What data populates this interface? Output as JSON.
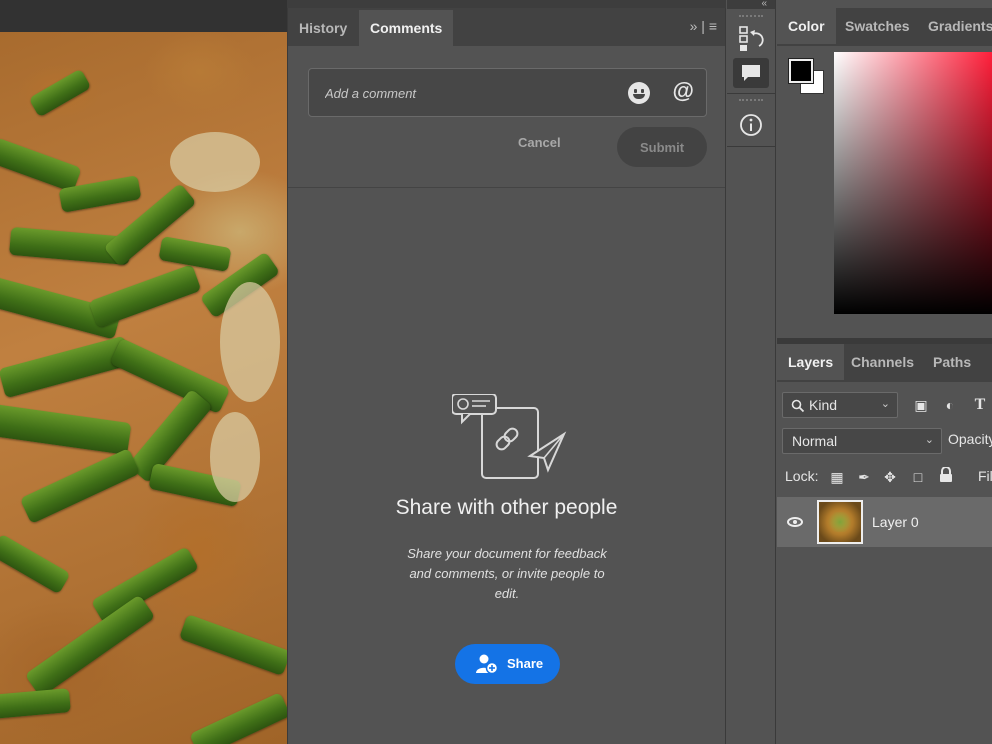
{
  "comments_panel": {
    "tabs": [
      {
        "label": "History"
      },
      {
        "label": "Comments"
      }
    ],
    "comment_placeholder": "Add a comment",
    "at_symbol": "@",
    "cancel_label": "Cancel",
    "submit_label": "Submit",
    "share_title": "Share with other people",
    "share_description": "Share your document for feedback and comments, or invite people to edit.",
    "share_button_label": "Share",
    "panel_tools": "» | ≡"
  },
  "icon_strip": {
    "collapse_glyph": "«",
    "items": [
      {
        "icon": "history-icon"
      },
      {
        "icon": "comments-icon",
        "active": true
      },
      {
        "icon": "info-icon"
      }
    ]
  },
  "color_panel": {
    "tabs": [
      {
        "label": "Color"
      },
      {
        "label": "Swatches"
      },
      {
        "label": "Gradients"
      }
    ],
    "foreground": "#000000",
    "background": "#ffffff",
    "hue_color": "#ff1f3a"
  },
  "layers_panel": {
    "tabs": [
      {
        "label": "Layers"
      },
      {
        "label": "Channels"
      },
      {
        "label": "Paths"
      }
    ],
    "filter_kind": "Kind",
    "blend_mode": "Normal",
    "opacity_label": "Opacity",
    "lock_label": "Lock:",
    "fill_label": "Fill",
    "layers": [
      {
        "name": "Layer 0",
        "visible": true
      }
    ]
  },
  "colors": {
    "accent": "#1473e6",
    "panel_bg": "#535353",
    "tabbar_bg": "#424242"
  }
}
